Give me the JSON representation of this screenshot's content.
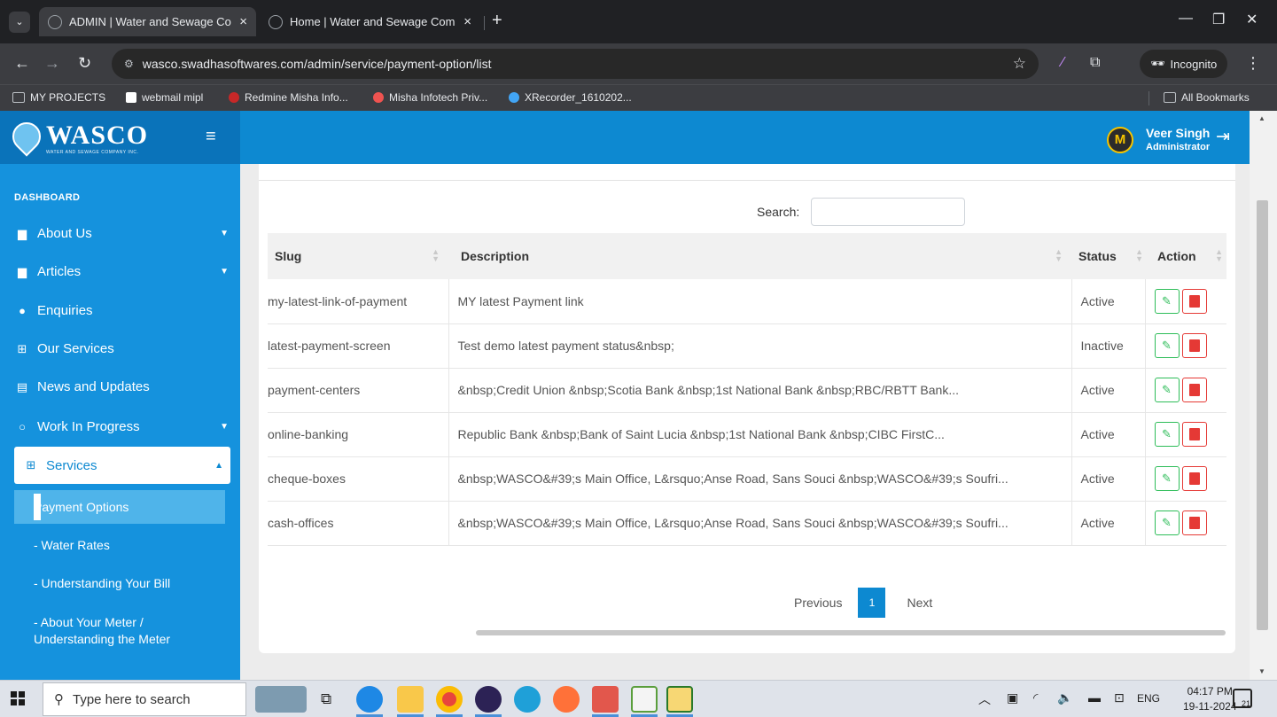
{
  "browser": {
    "tabs": [
      {
        "title": "ADMIN | Water and Sewage Co",
        "active": true
      },
      {
        "title": "Home | Water and Sewage Com",
        "active": false
      }
    ],
    "url": "wasco.swadhasoftwares.com/admin/service/payment-option/list",
    "incognito_label": "Incognito",
    "bookmarks": [
      "MY PROJECTS",
      "webmail mipl",
      "Redmine Misha Info...",
      "Misha Infotech Priv...",
      "XRecorder_1610202..."
    ],
    "all_bookmarks_label": "All Bookmarks"
  },
  "header": {
    "brand": "WASCO",
    "brand_tagline": "WATER AND SEWAGE COMPANY INC.",
    "avatar_initial": "M",
    "user_name": "Veer Singh",
    "user_role": "Administrator"
  },
  "sidebar": {
    "heading": "DASHBOARD",
    "items": [
      {
        "label": "About Us",
        "icon": "id-card-icon"
      },
      {
        "label": "Articles",
        "icon": "article-icon"
      },
      {
        "label": "Enquiries",
        "icon": "info-circle-icon"
      },
      {
        "label": "Our Services",
        "icon": "table-icon"
      },
      {
        "label": "News and Updates",
        "icon": "newspaper-icon"
      },
      {
        "label": "Work In Progress",
        "icon": "circle-icon"
      },
      {
        "label": "Services",
        "icon": "table-icon"
      }
    ],
    "sub_items": [
      {
        "label": "Payment Options",
        "active": true
      },
      {
        "label": "- Water Rates"
      },
      {
        "label": "- Understanding Your Bill"
      },
      {
        "label": "- About Your Meter / Understanding the Meter"
      }
    ]
  },
  "table": {
    "search_label": "Search:",
    "columns": [
      "Slug",
      "Description",
      "Status",
      "Action"
    ],
    "rows": [
      {
        "slug": "my-latest-link-of-payment",
        "description": "MY latest Payment link",
        "status": "Active"
      },
      {
        "slug": "latest-payment-screen",
        "description": "Test demo latest payment status&nbsp;",
        "status": "Inactive"
      },
      {
        "slug": "payment-centers",
        "description": "&nbsp;Credit Union &nbsp;Scotia Bank &nbsp;1st National Bank &nbsp;RBC/RBTT Bank...",
        "status": "Active"
      },
      {
        "slug": "online-banking",
        "description": "Republic Bank &nbsp;Bank of Saint Lucia &nbsp;1st National Bank &nbsp;CIBC FirstC...",
        "status": "Active"
      },
      {
        "slug": "cheque-boxes",
        "description": "&nbsp;WASCO&#39;s Main Office, L&rsquo;Anse Road, Sans Souci &nbsp;WASCO&#39;s Soufri...",
        "status": "Active"
      },
      {
        "slug": "cash-offices",
        "description": "&nbsp;WASCO&#39;s Main Office, L&rsquo;Anse Road, Sans Souci &nbsp;WASCO&#39;s Soufri...",
        "status": "Active"
      }
    ],
    "pagination": {
      "previous": "Previous",
      "current_page": "1",
      "next": "Next"
    }
  },
  "taskbar": {
    "search_placeholder": "Type here to search",
    "language": "ENG",
    "time": "04:17 PM",
    "date": "19-11-2024",
    "notification_count": "21"
  },
  "colors": {
    "brand_blue": "#0d89d1",
    "sidebar_blue": "#1592dd",
    "edit_green": "#2ebd59",
    "delete_red": "#e53935"
  }
}
